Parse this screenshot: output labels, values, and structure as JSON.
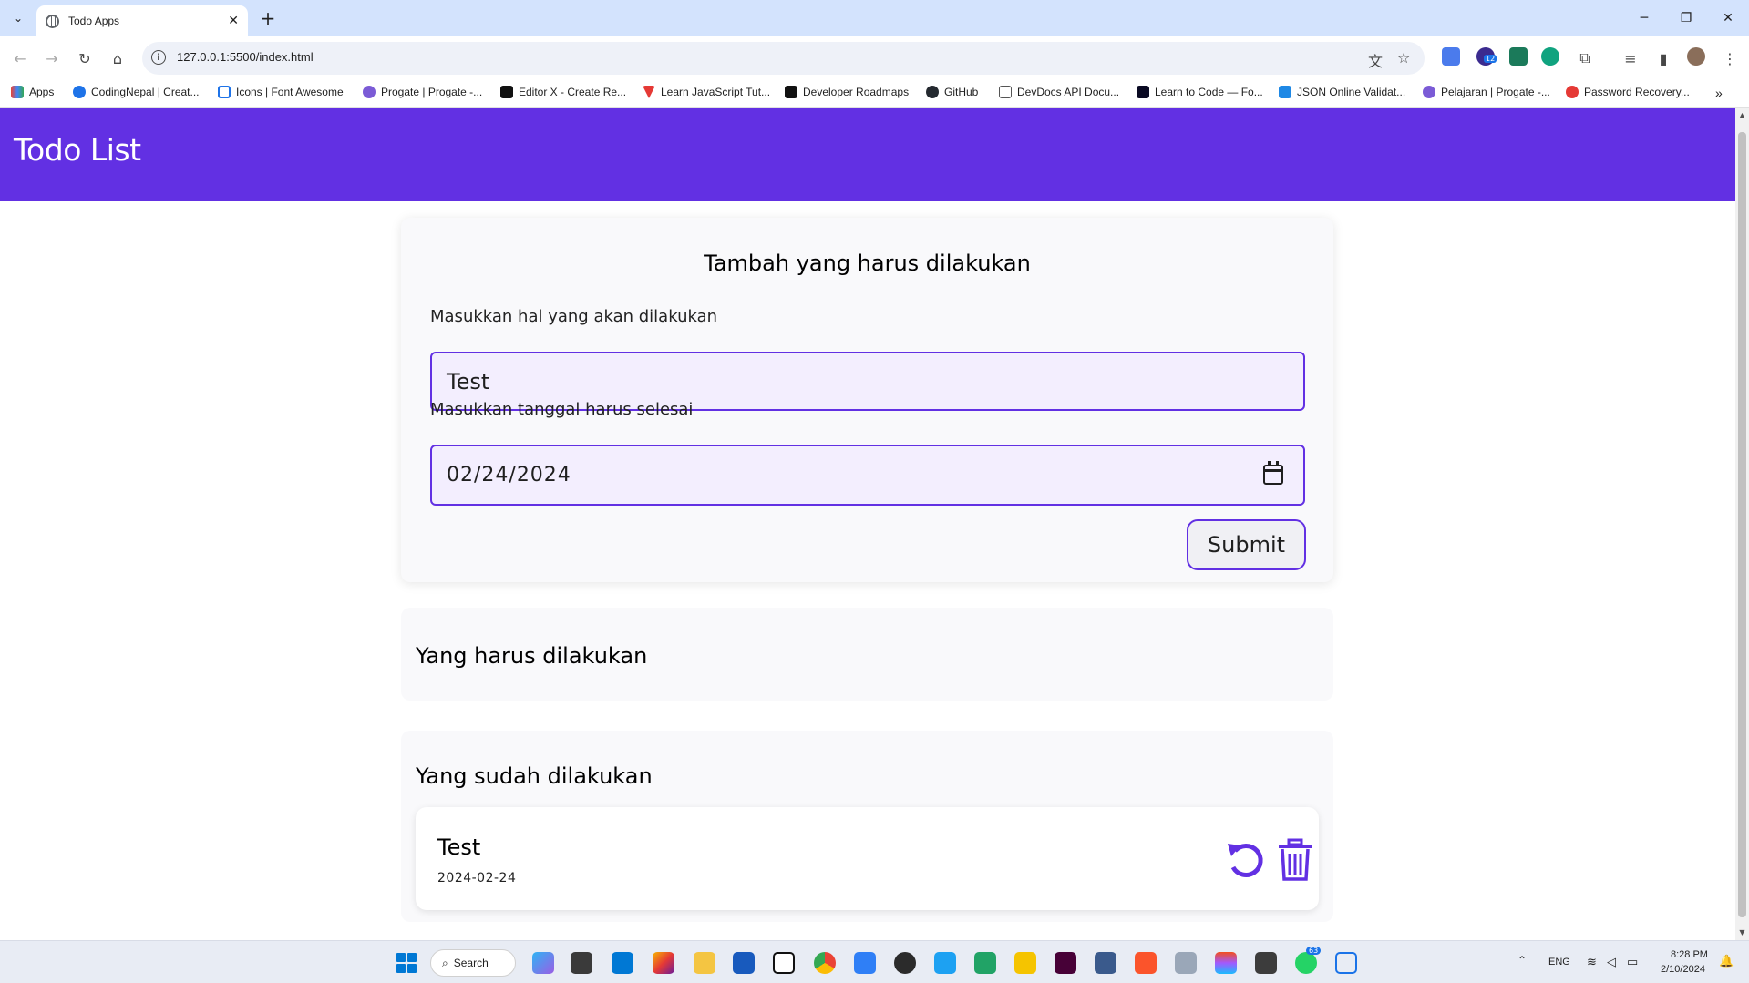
{
  "browser": {
    "tab_title": "Todo Apps",
    "url": "127.0.0.1:5500/index.html",
    "bookmarks": [
      "Apps",
      "CodingNepal | Creat...",
      "Icons | Font Awesome",
      "Progate | Progate -...",
      "Editor X - Create Re...",
      "Learn JavaScript Tut...",
      "Developer Roadmaps",
      "GitHub",
      "DevDocs API Docu...",
      "Learn to Code — Fo...",
      "JSON Online Validat...",
      "Pelajaran | Progate -...",
      "Password Recovery..."
    ],
    "extension_badge": "12"
  },
  "app": {
    "header_title": "Todo List",
    "form": {
      "title": "Tambah yang harus dilakukan",
      "title_label": "Masukkan hal yang akan dilakukan",
      "title_value": "Test",
      "date_label": "Masukkan tanggal harus selesai",
      "date_value": "02/24/2024",
      "submit_label": "Submit"
    },
    "todo_section": {
      "title": "Yang harus dilakukan",
      "items": []
    },
    "done_section": {
      "title": "Yang sudah dilakukan",
      "items": [
        {
          "title": "Test",
          "date": "2024-02-24"
        }
      ]
    },
    "accent_color": "#6230e3"
  },
  "taskbar": {
    "search_label": "Search",
    "language": "ENG",
    "time": "8:28 PM",
    "date": "2/10/2024",
    "whatsapp_badge": "63"
  }
}
